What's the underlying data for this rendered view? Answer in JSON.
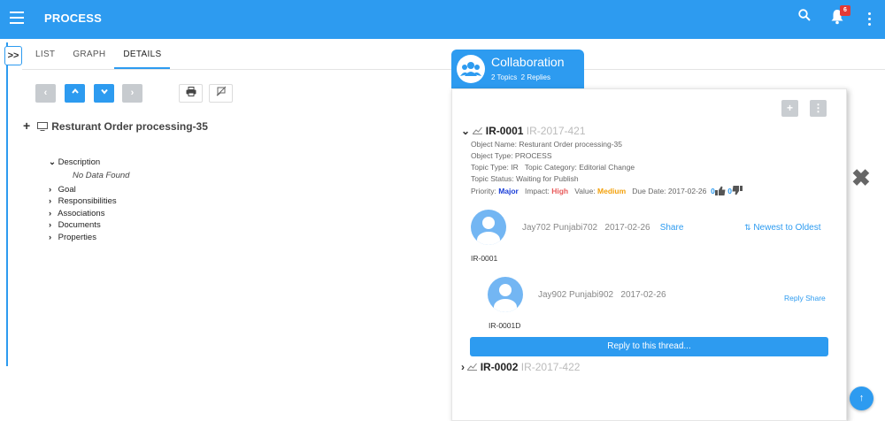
{
  "app": {
    "title": "PROCESS",
    "notification_count": "6"
  },
  "tabs": [
    {
      "label": "LIST"
    },
    {
      "label": "GRAPH"
    },
    {
      "label": "DETAILS"
    }
  ],
  "object": {
    "title": "Resturant Order processing-35"
  },
  "tree": {
    "description_label": "Description",
    "no_data": "No Data Found",
    "items": [
      "Goal",
      "Responsibilities",
      "Associations",
      "Documents",
      "Properties"
    ]
  },
  "collaboration": {
    "title": "Collaboration",
    "topics": "2 Topics",
    "replies": "2 Replies",
    "thread1": {
      "id": "IR-0001",
      "sub_id": "IR-2017-421",
      "object_name": "Object Name: Resturant Order processing-35",
      "object_type": "Object Type: PROCESS",
      "topic_type": "Topic Type: IR",
      "topic_category": "Topic Category: Editorial Change",
      "topic_status": "Topic Status: Waiting for Publish",
      "priority_label": "Priority:",
      "priority_value": "Major",
      "impact_label": "Impact:",
      "impact_value": "High",
      "value_label": "Value:",
      "value_value": "Medium",
      "due_date": "Due Date: 2017-02-26",
      "likes": "0",
      "dislikes": "0",
      "comment": {
        "author": "Jay702 Punjabi702",
        "date": "2017-02-26",
        "share": "Share",
        "sort": "Newest to Oldest",
        "caption": "IR-0001"
      },
      "reply": {
        "author": "Jay902 Punjabi902",
        "date": "2017-02-26",
        "actions": "Reply Share",
        "caption": "IR-0001D"
      },
      "reply_button": "Reply to this thread..."
    },
    "thread2": {
      "id": "IR-0002",
      "sub_id": "IR-2017-422"
    }
  },
  "colors": {
    "primary": "#2d9bf0",
    "major": "#1a3ed8",
    "high": "#e85a5a",
    "medium": "#f3a10c"
  }
}
